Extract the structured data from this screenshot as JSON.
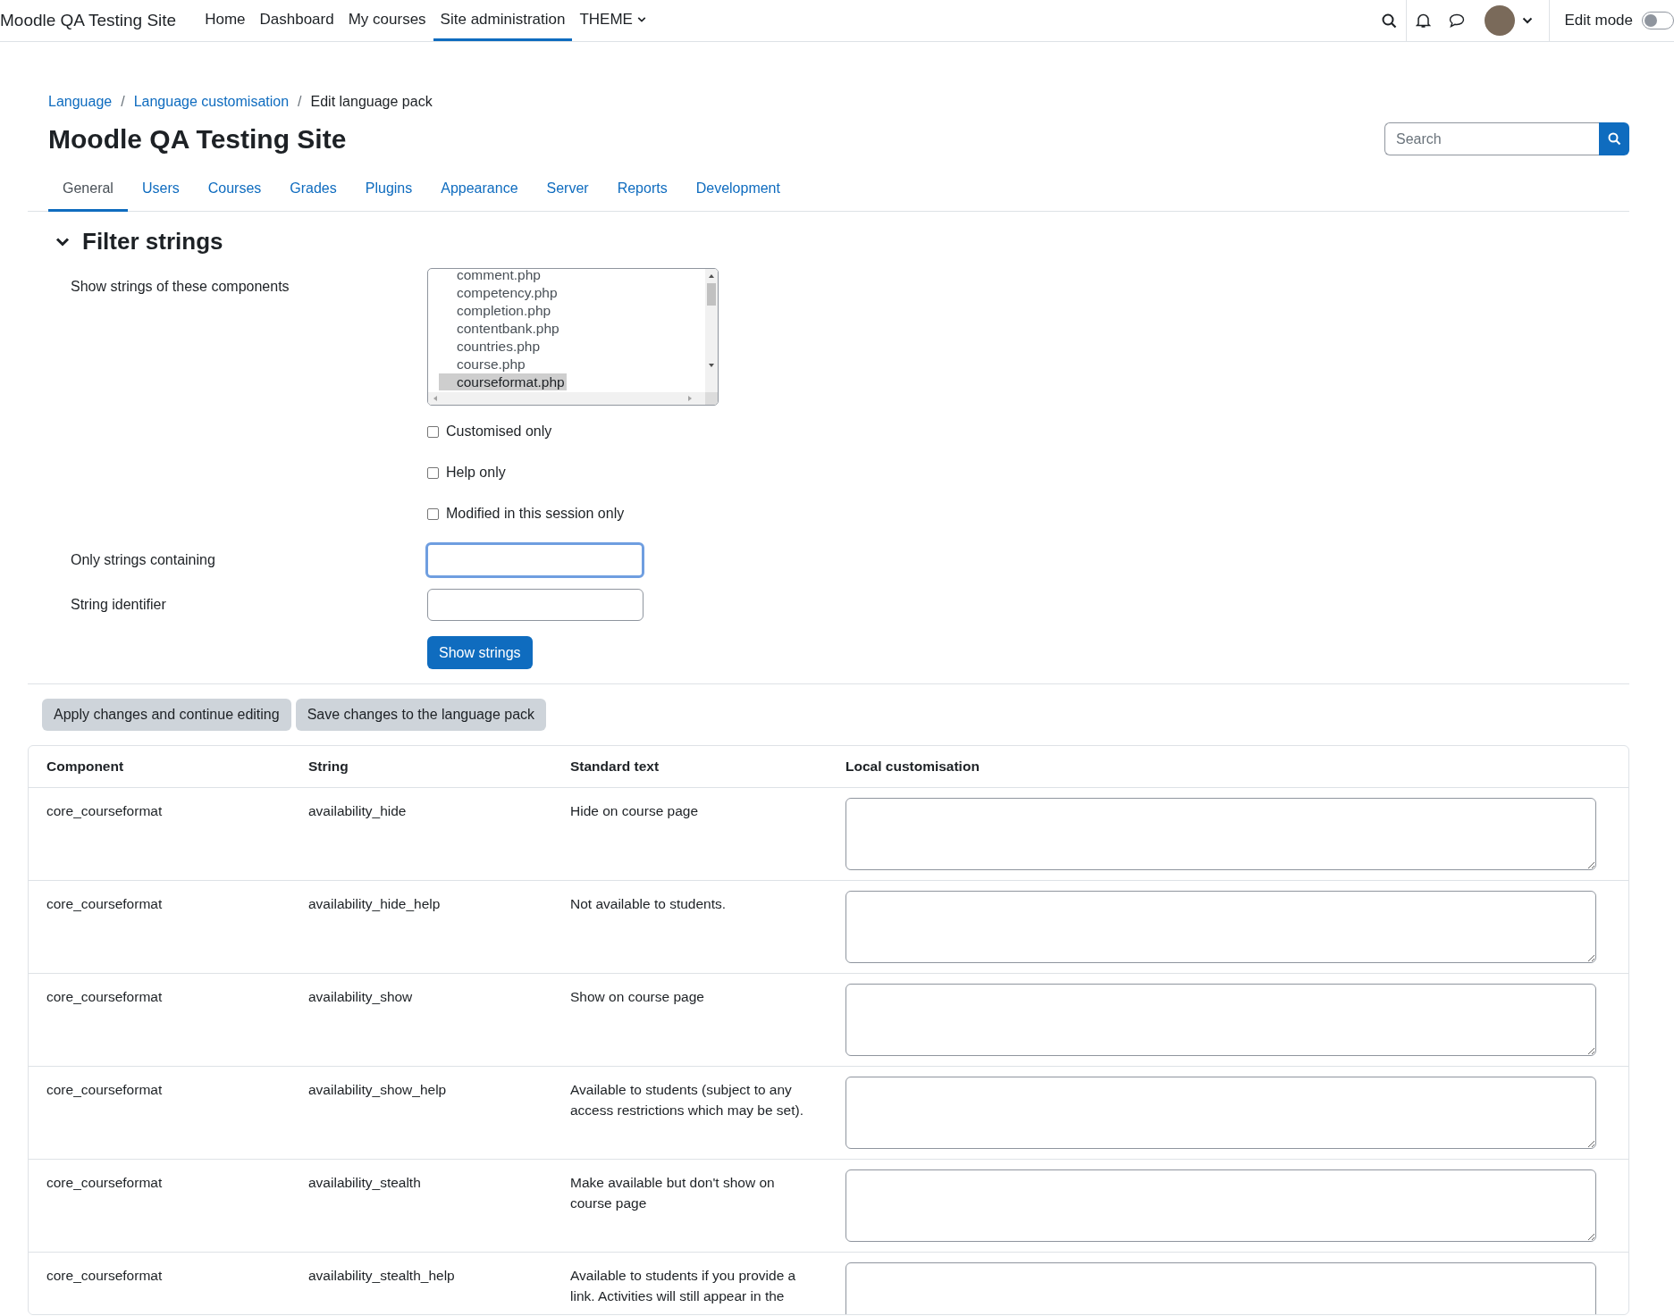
{
  "navbar": {
    "site_name": "Moodle QA Testing Site",
    "links": [
      {
        "label": "Home",
        "selected": false
      },
      {
        "label": "Dashboard",
        "selected": false
      },
      {
        "label": "My courses",
        "selected": false
      },
      {
        "label": "Site administration",
        "selected": true
      },
      {
        "label": "THEME",
        "selected": false,
        "kind": "dropdown"
      }
    ],
    "edit_mode": {
      "label": "Edit mode",
      "on": false
    }
  },
  "breadcrumb": [
    {
      "label": "Language",
      "kind": "link"
    },
    {
      "label": "/",
      "kind": "separator"
    },
    {
      "label": "Language customisation",
      "kind": "link"
    },
    {
      "label": "/",
      "kind": "separator"
    },
    {
      "label": "Edit language pack",
      "kind": "current"
    }
  ],
  "page_title": "Moodle QA Testing Site",
  "search": {
    "placeholder": "Search"
  },
  "tabs": [
    {
      "label": "General",
      "selected": true
    },
    {
      "label": "Users",
      "selected": false
    },
    {
      "label": "Courses",
      "selected": false
    },
    {
      "label": "Grades",
      "selected": false
    },
    {
      "label": "Plugins",
      "selected": false
    },
    {
      "label": "Appearance",
      "selected": false
    },
    {
      "label": "Server",
      "selected": false
    },
    {
      "label": "Reports",
      "selected": false
    },
    {
      "label": "Development",
      "selected": false
    }
  ],
  "filter": {
    "title": "Filter strings",
    "expanded": true,
    "components": {
      "label": "Show strings of these components",
      "options": [
        {
          "label": "comment.php",
          "selected": false
        },
        {
          "label": "competency.php",
          "selected": false
        },
        {
          "label": "completion.php",
          "selected": false
        },
        {
          "label": "contentbank.php",
          "selected": false
        },
        {
          "label": "countries.php",
          "selected": false
        },
        {
          "label": "course.php",
          "selected": false
        },
        {
          "label": "courseformat.php",
          "selected": true
        }
      ]
    },
    "checkboxes": [
      {
        "label": "Customised only",
        "checked": false
      },
      {
        "label": "Help only",
        "checked": false
      },
      {
        "label": "Modified in this session only",
        "checked": false
      }
    ],
    "fields": [
      {
        "label": "Only strings containing",
        "focused": true
      },
      {
        "label": "String identifier",
        "focused": false
      }
    ],
    "submit": "Show strings"
  },
  "actions": [
    "Apply changes and continue editing",
    "Save changes to the language pack"
  ],
  "table": {
    "columns": [
      "Component",
      "String",
      "Standard text",
      "Local customisation"
    ],
    "rows": [
      {
        "component": "core_courseformat",
        "string": "availability_hide",
        "standard_text": "Hide on course page"
      },
      {
        "component": "core_courseformat",
        "string": "availability_hide_help",
        "standard_text": "Not available to students."
      },
      {
        "component": "core_courseformat",
        "string": "availability_show",
        "standard_text": "Show on course page"
      },
      {
        "component": "core_courseformat",
        "string": "availability_show_help",
        "standard_text": "Available to students (subject to any access restrictions which may be set)."
      },
      {
        "component": "core_courseformat",
        "string": "availability_stealth",
        "standard_text": "Make available but don't show on course page"
      },
      {
        "component": "core_courseformat",
        "string": "availability_stealth_help",
        "standard_text": "Available to students if you provide a link. Activities will still appear in the"
      }
    ]
  }
}
